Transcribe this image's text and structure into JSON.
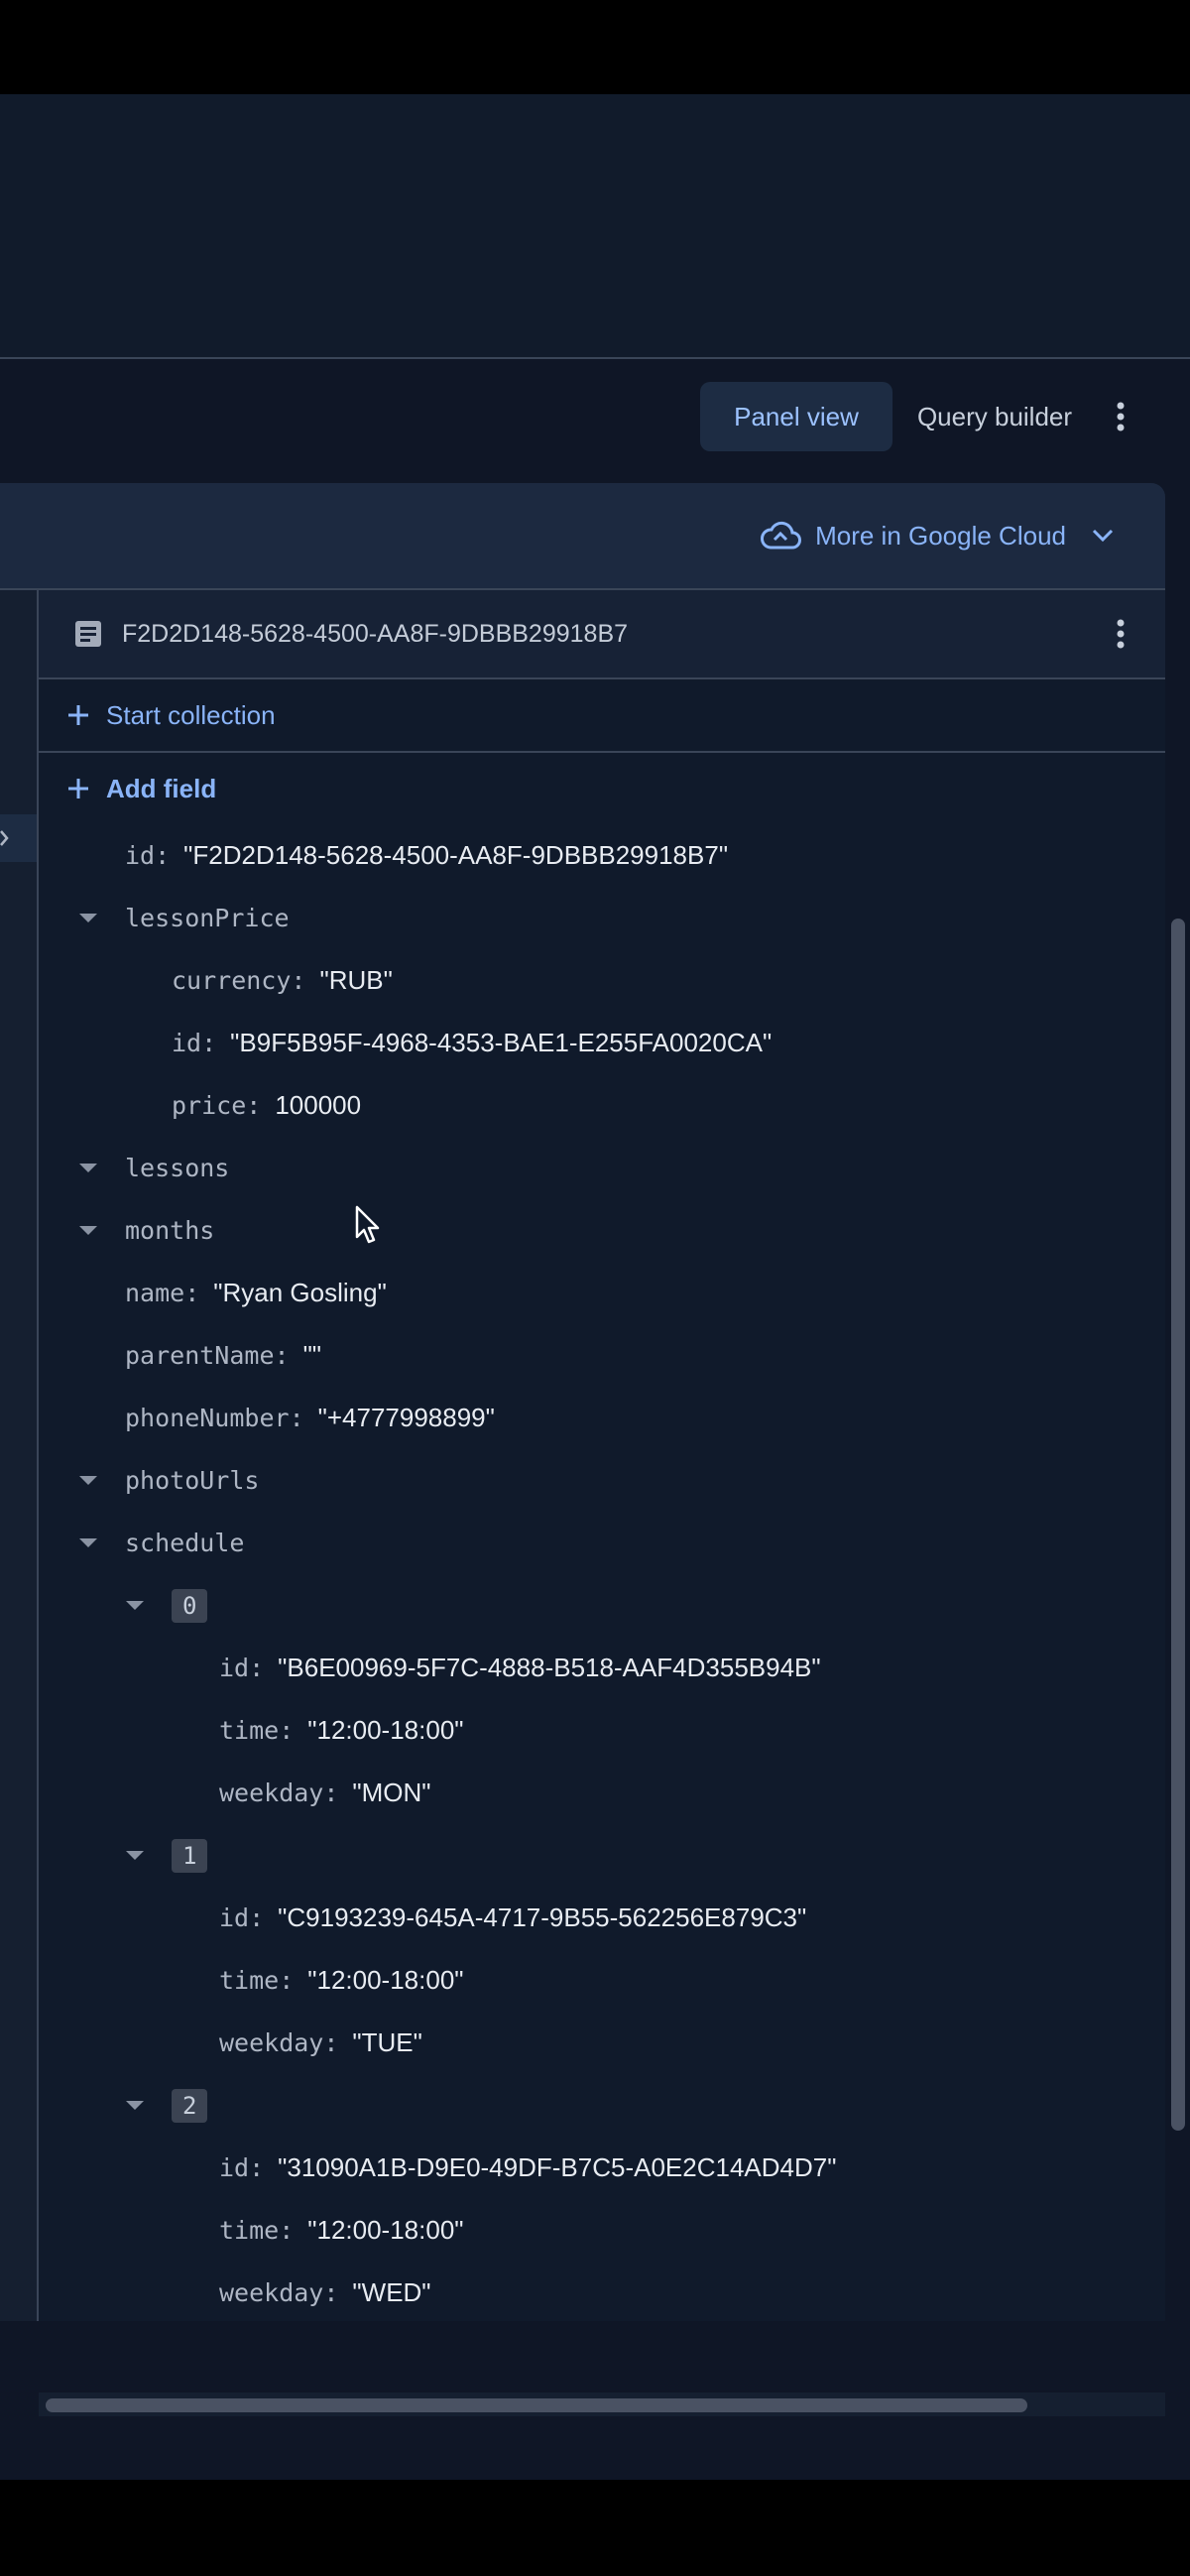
{
  "toolbar": {
    "panel_view": "Panel view",
    "query_builder": "Query builder",
    "more_menu_icon": "more-vert-icon"
  },
  "panel": {
    "cloud_link": "More in Google Cloud",
    "cloud_icon": "cloud-icon",
    "expand_icon": "chevron-down-icon"
  },
  "document": {
    "icon": "document-icon",
    "id": "F2D2D148-5628-4500-AA8F-9DBBB29918B7",
    "menu_icon": "more-vert-icon",
    "start_collection": "Start collection",
    "add_field": "Add field"
  },
  "fields": {
    "id": {
      "key": "id:",
      "value": "\"F2D2D148-5628-4500-AA8F-9DBBB29918B7\""
    },
    "lessonPrice": {
      "key": "lessonPrice",
      "currency": {
        "key": "currency:",
        "value": "\"RUB\""
      },
      "id": {
        "key": "id:",
        "value": "\"B9F5B95F-4968-4353-BAE1-E255FA0020CA\""
      },
      "price": {
        "key": "price:",
        "value": "100000"
      }
    },
    "lessons": {
      "key": "lessons"
    },
    "months": {
      "key": "months"
    },
    "name": {
      "key": "name:",
      "value": "\"Ryan Gosling\""
    },
    "parentName": {
      "key": "parentName:",
      "value": "\"\""
    },
    "phoneNumber": {
      "key": "phoneNumber:",
      "value": "\"+4777998899\""
    },
    "photoUrls": {
      "key": "photoUrls"
    },
    "schedule": {
      "key": "schedule",
      "items": [
        {
          "index": "0",
          "id": {
            "key": "id:",
            "value": "\"B6E00969-5F7C-4888-B518-AAF4D355B94B\""
          },
          "time": {
            "key": "time:",
            "value": "\"12:00-18:00\""
          },
          "weekday": {
            "key": "weekday:",
            "value": "\"MON\""
          }
        },
        {
          "index": "1",
          "id": {
            "key": "id:",
            "value": "\"C9193239-645A-4717-9B55-562256E879C3\""
          },
          "time": {
            "key": "time:",
            "value": "\"12:00-18:00\""
          },
          "weekday": {
            "key": "weekday:",
            "value": "\"TUE\""
          }
        },
        {
          "index": "2",
          "id": {
            "key": "id:",
            "value": "\"31090A1B-D9E0-49DF-B7C5-A0E2C14AD4D7\""
          },
          "time": {
            "key": "time:",
            "value": "\"12:00-18:00\""
          },
          "weekday": {
            "key": "weekday:",
            "value": "\"WED\""
          }
        }
      ]
    }
  },
  "colors": {
    "background": "#0f1626",
    "accent": "#8ab4f8",
    "panel": "#151f30"
  }
}
